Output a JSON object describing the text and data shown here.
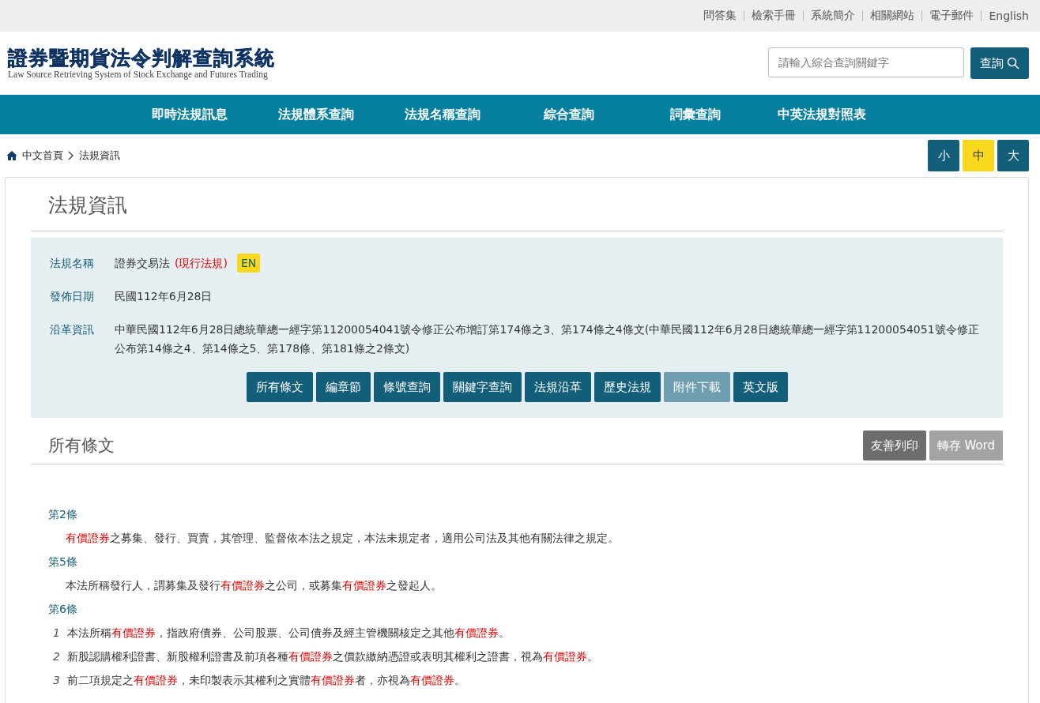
{
  "top_links": [
    "問答集",
    "檢索手冊",
    "系統簡介",
    "相關網站",
    "電子郵件",
    "English"
  ],
  "logo": {
    "title": "證券暨期貨法令判解查詢系統",
    "subtitle": "Law Source Retrieving System of Stock Exchange and Futures Trading"
  },
  "search": {
    "placeholder": "請輸入綜合查詢關鍵字",
    "button": "查詢"
  },
  "nav": [
    "即時法規訊息",
    "法規體系查詢",
    "法規名稱查詢",
    "綜合查詢",
    "詞彙查詢",
    "中英法規對照表"
  ],
  "breadcrumb": [
    "中文首頁",
    "法規資訊"
  ],
  "font_sizes": [
    {
      "label": "小",
      "selected": false
    },
    {
      "label": "中",
      "selected": true
    },
    {
      "label": "大",
      "selected": false
    }
  ],
  "page_title": "法規資訊",
  "info": {
    "rows": [
      {
        "label": "法規名稱",
        "value": "證券交易法",
        "status": "(現行法規)",
        "badge": "EN"
      },
      {
        "label": "發佈日期",
        "value": "民國112年6月28日"
      },
      {
        "label": "沿革資訊",
        "value": "中華民國112年6月28日總統華總一經字第11200054041號令修正公布增訂第174條之3、第174條之4條文(中華民國112年6月28日總統華總一經字第11200054051號令修正公布第14條之4、第14條之5、第178條、第181條之2條文)"
      }
    ],
    "buttons": [
      {
        "label": "所有條文",
        "disabled": false
      },
      {
        "label": "編章節",
        "disabled": false
      },
      {
        "label": "條號查詢",
        "disabled": false
      },
      {
        "label": "關鍵字查詢",
        "disabled": false
      },
      {
        "label": "法規沿革",
        "disabled": false
      },
      {
        "label": "歷史法規",
        "disabled": false
      },
      {
        "label": "附件下載",
        "disabled": true
      },
      {
        "label": "英文版",
        "disabled": false
      }
    ]
  },
  "section": {
    "title": "所有條文",
    "actions": [
      {
        "label": "友善列印",
        "kind": "dark"
      },
      {
        "label": "轉存 Word",
        "kind": "light"
      }
    ]
  },
  "articles": [
    {
      "title": "第2條",
      "paragraphs": [
        {
          "segments": [
            {
              "text": "有價證券",
              "highlight": true
            },
            {
              "text": "之募集、發行、買賣，其管理、監督依本法之規定，本法未規定者，適用公司法及其他有關法律之規定。",
              "highlight": false
            }
          ]
        }
      ]
    },
    {
      "title": "第5條",
      "paragraphs": [
        {
          "segments": [
            {
              "text": "本法所稱發行人，謂募集及發行",
              "highlight": false
            },
            {
              "text": "有價證券",
              "highlight": true
            },
            {
              "text": "之公司，或募集",
              "highlight": false
            },
            {
              "text": "有價證券",
              "highlight": true
            },
            {
              "text": "之發起人。",
              "highlight": false
            }
          ]
        }
      ]
    },
    {
      "title": "第6條",
      "paragraphs": [
        {
          "number": "1",
          "segments": [
            {
              "text": "本法所稱",
              "highlight": false
            },
            {
              "text": "有價證券",
              "highlight": true
            },
            {
              "text": "，指政府債券、公司股票、公司債券及經主管機關核定之其他",
              "highlight": false
            },
            {
              "text": "有價證券",
              "highlight": true
            },
            {
              "text": "。",
              "highlight": false
            }
          ]
        },
        {
          "number": "2",
          "segments": [
            {
              "text": "新股認購權利證書、新股權利證書及前項各種",
              "highlight": false
            },
            {
              "text": "有價證券",
              "highlight": true
            },
            {
              "text": "之價款繳納憑證或表明其權利之證書，視為",
              "highlight": false
            },
            {
              "text": "有價證券",
              "highlight": true
            },
            {
              "text": "。",
              "highlight": false
            }
          ]
        },
        {
          "number": "3",
          "segments": [
            {
              "text": "前二項規定之",
              "highlight": false
            },
            {
              "text": "有價證券",
              "highlight": true
            },
            {
              "text": "，未印製表示其權利之實體",
              "highlight": false
            },
            {
              "text": "有價證券",
              "highlight": true
            },
            {
              "text": "者，亦視為",
              "highlight": false
            },
            {
              "text": "有價證券",
              "highlight": true
            },
            {
              "text": "。",
              "highlight": false
            }
          ]
        }
      ]
    }
  ]
}
